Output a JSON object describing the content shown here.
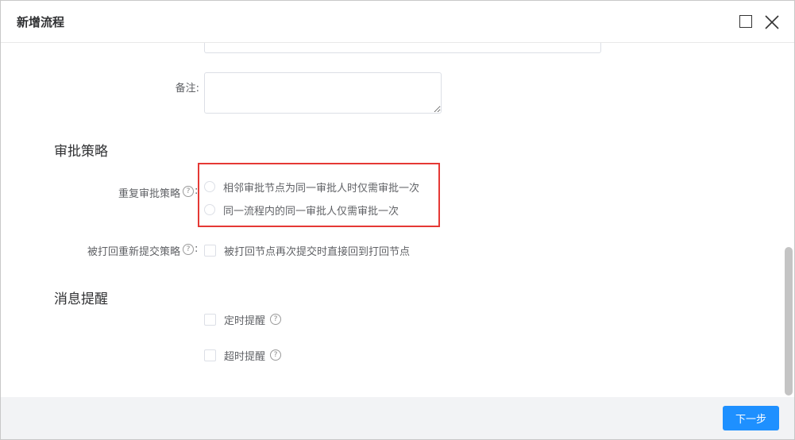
{
  "dialog": {
    "title": "新增流程",
    "maximize_icon": "maximize-icon",
    "close_icon": "close-icon"
  },
  "form": {
    "remark": {
      "label": "备注",
      "colon": ":",
      "value": ""
    },
    "approval_section": {
      "title": "审批策略",
      "repeat_policy": {
        "label": "重复审批策略",
        "help_icon": "question-circle-icon",
        "options": [
          "相邻审批节点为同一审批人时仅需审批一次",
          "同一流程内的同一审批人仅需审批一次"
        ]
      },
      "reject_policy": {
        "label": "被打回重新提交策略",
        "help_icon": "question-circle-icon",
        "checkbox_label": "被打回节点再次提交时直接回到打回节点"
      }
    },
    "message_section": {
      "title": "消息提醒",
      "timed_reminder": "定时提醒",
      "overtime_reminder": "超时提醒"
    }
  },
  "footer": {
    "next_label": "下一步"
  },
  "colors": {
    "primary": "#1e90ff",
    "highlight": "#e53935",
    "footer_bg": "#f2f3f5"
  }
}
